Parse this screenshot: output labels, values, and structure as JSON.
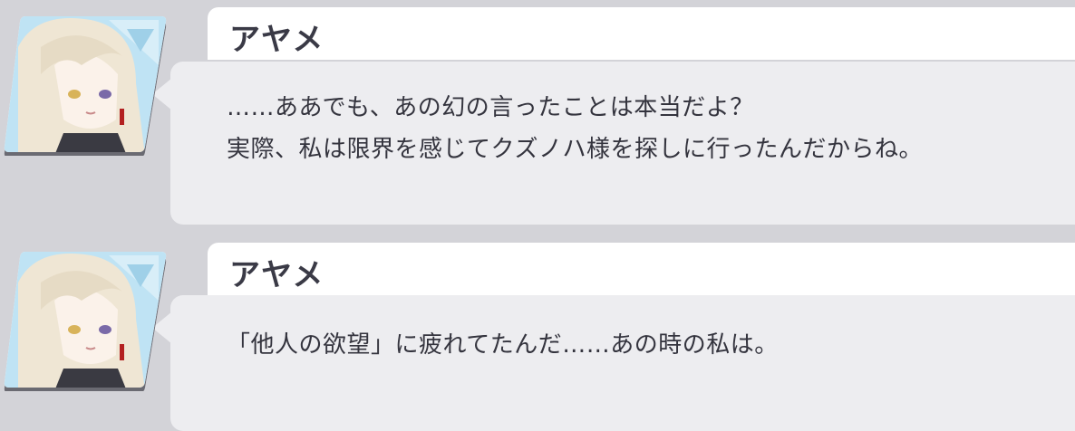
{
  "messages": [
    {
      "speaker": "アヤメ",
      "lines": [
        "……ああでも、あの幻の言ったことは本当だよ？",
        "実際、私は限界を感じてクズノハ様を探しに行ったんだからね。"
      ]
    },
    {
      "speaker": "アヤメ",
      "lines": [
        "「他人の欲望」に疲れてたんだ……あの時の私は。"
      ]
    }
  ],
  "colors": {
    "background": "#d3d3d8",
    "name_plate": "#ffffff",
    "bubble": "#ededf0",
    "text": "#34343e",
    "avatar_bg": "#bfe3f4",
    "hair": "#efe6d4"
  },
  "icons": {
    "avatar": "character-portrait-ayame"
  }
}
